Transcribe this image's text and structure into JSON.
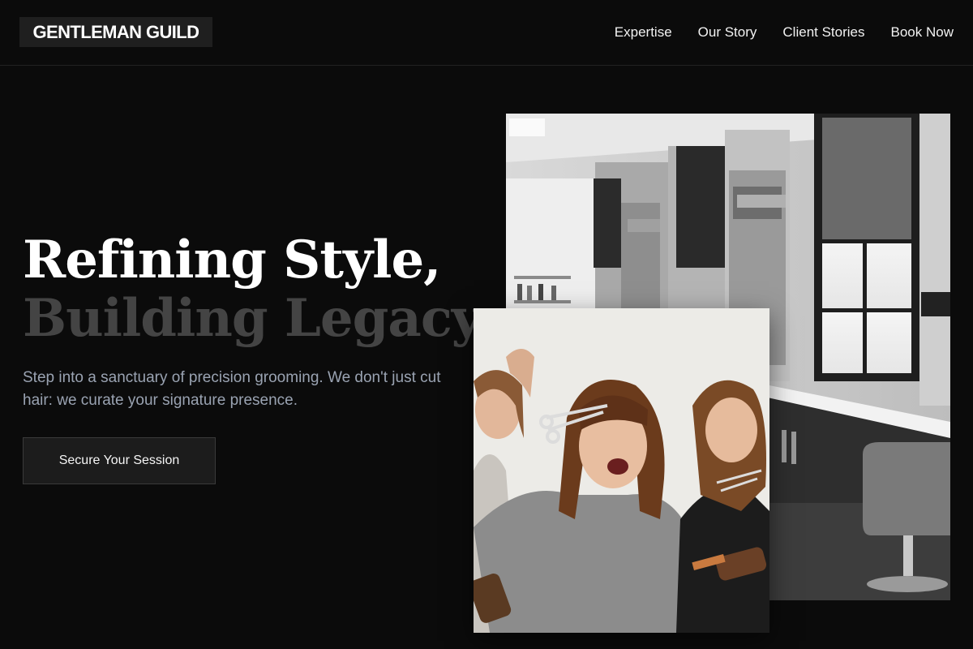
{
  "brand": {
    "name": "GENTLEMAN GUILD"
  },
  "nav": {
    "items": [
      {
        "label": "Expertise"
      },
      {
        "label": "Our Story"
      },
      {
        "label": "Client Stories"
      },
      {
        "label": "Book Now"
      }
    ]
  },
  "hero": {
    "headline_line1": "Refining Style,",
    "headline_line2": "Building Legacy.",
    "subtext": "Step into a sanctuary of precision grooming. We don't just cut hair: we curate your signature presence.",
    "cta_label": "Secure Your Session"
  },
  "images": {
    "salon_interior": {
      "icon": "salon-interior-photo"
    },
    "stylists": {
      "icon": "stylists-photo"
    }
  },
  "colors": {
    "background": "#0b0b0b",
    "headline_primary": "#ffffff",
    "headline_secondary": "#444444",
    "subtext": "#9aa3b2",
    "button_bg": "#1c1c1c"
  }
}
